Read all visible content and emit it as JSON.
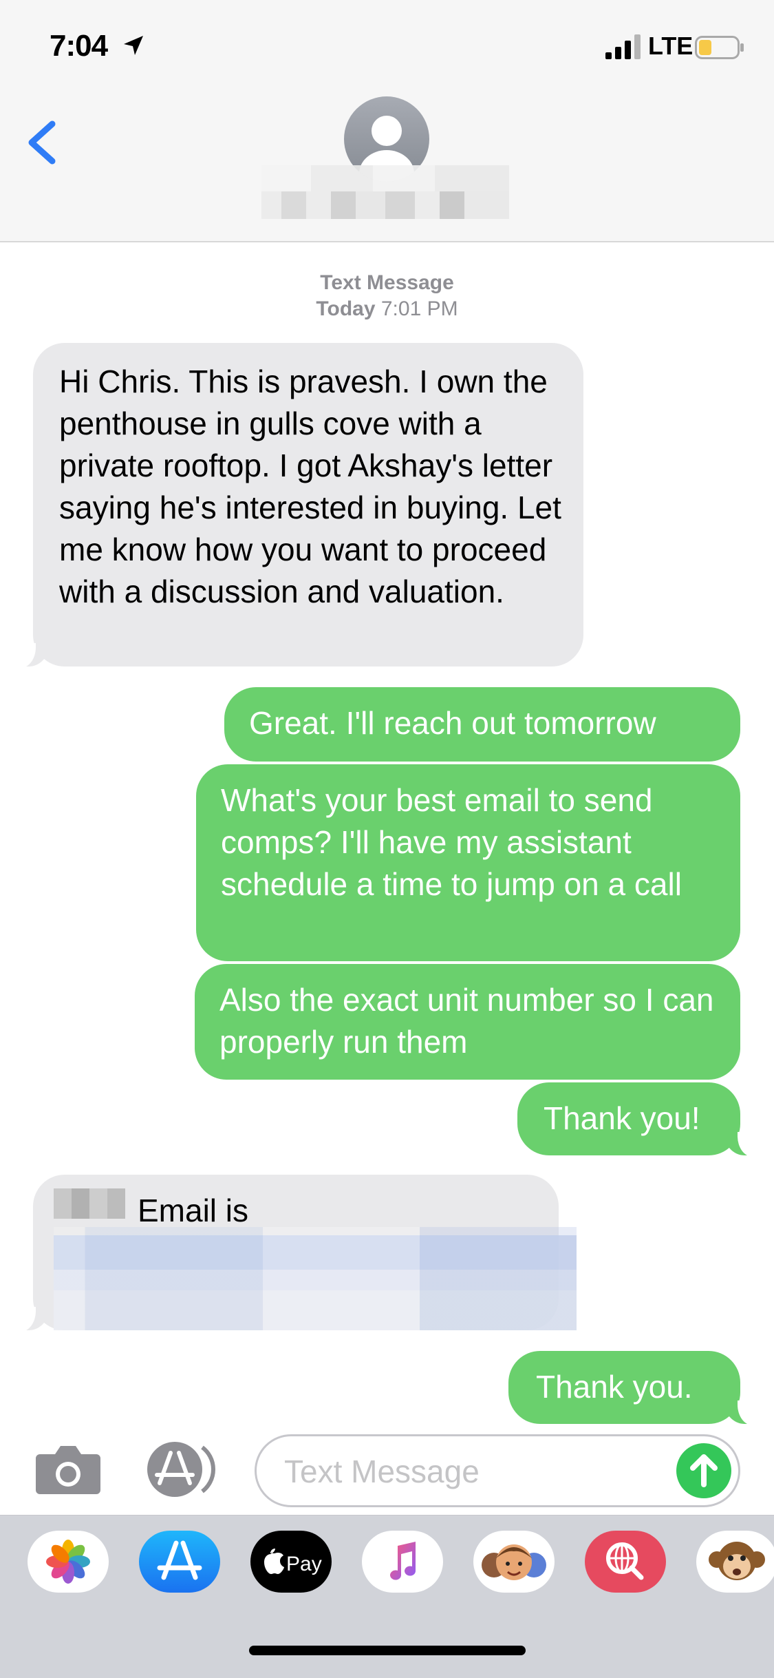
{
  "status_bar": {
    "time": "7:04",
    "network": "LTE",
    "icons": [
      "location-arrow-icon",
      "signal-bars-icon",
      "battery-icon"
    ]
  },
  "header": {
    "icons": [
      "chevron-left-icon",
      "contact-avatar-icon"
    ]
  },
  "thread": {
    "service_label": "Text Message",
    "date_label": "Today",
    "time_label": "7:01 PM",
    "messages": [
      {
        "direction": "incoming",
        "text": "Hi Chris. This is pravesh. I own the penthouse in gulls cove with a private rooftop. I got Akshay's letter saying he's interested in buying. Let me know how you want to proceed with a discussion and valuation."
      },
      {
        "direction": "outgoing",
        "text": "Great. I'll reach out tomorrow"
      },
      {
        "direction": "outgoing",
        "text": "What's your best email to send comps? I'll have my assistant schedule a time to jump on a call"
      },
      {
        "direction": "outgoing",
        "text": "Also the exact unit number so I can properly run them"
      },
      {
        "direction": "outgoing",
        "text": "Thank you!"
      },
      {
        "direction": "incoming",
        "text": "Email is"
      },
      {
        "direction": "outgoing",
        "text": "Thank you."
      }
    ]
  },
  "compose": {
    "placeholder": "Text Message",
    "icons": [
      "camera-icon",
      "app-store-icon",
      "send-arrow-icon"
    ]
  },
  "app_drawer": {
    "apps": [
      {
        "name": "photos-app-icon"
      },
      {
        "name": "app-store-app-icon"
      },
      {
        "name": "apple-pay-app-icon",
        "label": "Pay"
      },
      {
        "name": "music-app-icon"
      },
      {
        "name": "memoji-app-icon"
      },
      {
        "name": "web-images-app-icon"
      },
      {
        "name": "animoji-app-icon"
      }
    ]
  },
  "colors": {
    "outgoing_bubble": "#6ad06d",
    "incoming_bubble": "#e9e9eb",
    "accent_blue": "#2f7cf6",
    "send_green": "#34c759"
  }
}
